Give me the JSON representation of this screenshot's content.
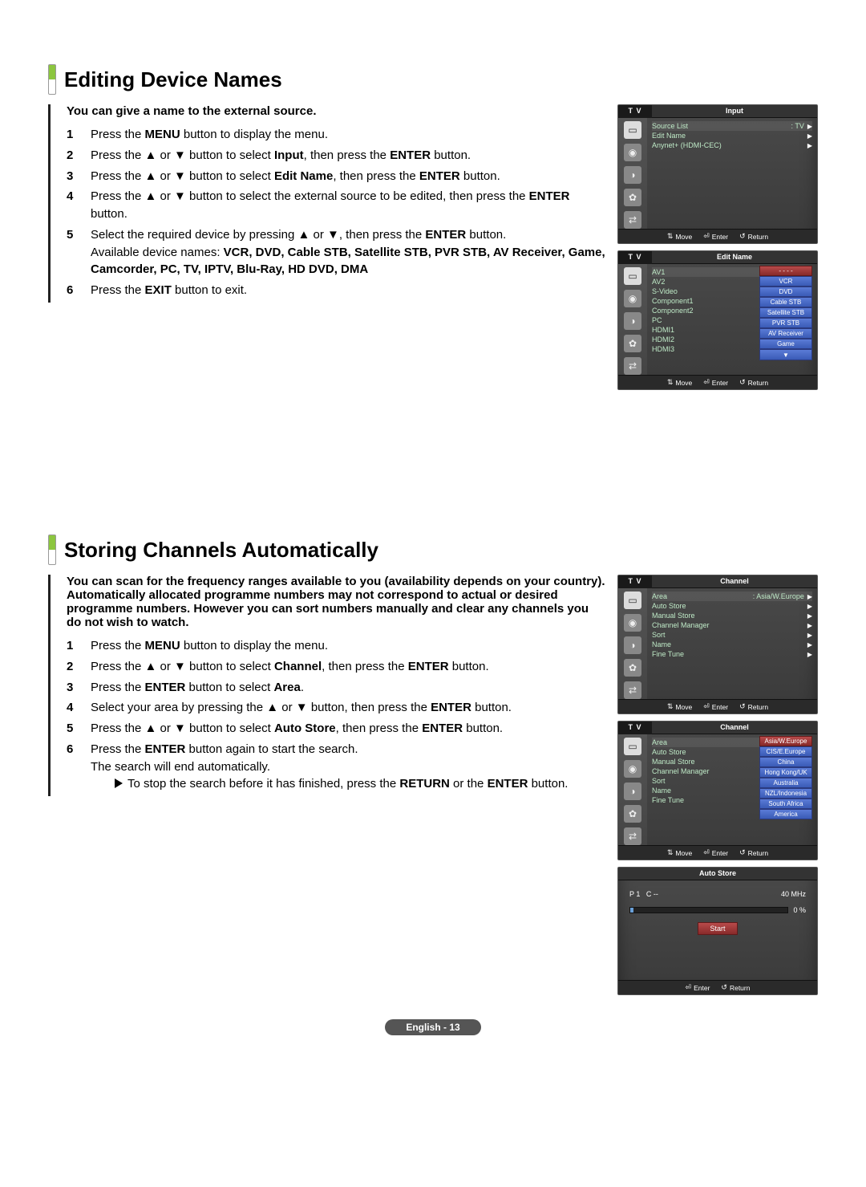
{
  "section1": {
    "title": "Editing Device Names",
    "intro": "You can give a name to the external source.",
    "steps": [
      {
        "n": "1",
        "pre": "Press the ",
        "b1": "MENU",
        "post": " button to display the menu."
      },
      {
        "n": "2",
        "pre": "Press the ▲ or ▼ button to select ",
        "b1": "Input",
        "mid": ", then press the ",
        "b2": "ENTER",
        "post": " button."
      },
      {
        "n": "3",
        "pre": "Press the ▲ or ▼ button to select ",
        "b1": "Edit Name",
        "mid": ", then press the ",
        "b2": "ENTER",
        "post": " button."
      },
      {
        "n": "4",
        "pre": "Press the ▲ or ▼ button to select the external source to be edited, then press the ",
        "b1": "ENTER",
        "post": " button."
      },
      {
        "n": "5",
        "pre": "Select the required device by pressing ▲ or ▼, then press the ",
        "b1": "ENTER",
        "mid": " button.",
        "avail_pre": "Available device names: ",
        "avail_bold": "VCR, DVD, Cable STB, Satellite STB, PVR STB, AV Receiver, Game, Camcorder, PC, TV, IPTV, Blu-Ray, HD DVD, DMA"
      },
      {
        "n": "6",
        "pre": "Press the ",
        "b1": "EXIT",
        "post": " button to exit."
      }
    ]
  },
  "osd_input": {
    "tv": "T V",
    "title": "Input",
    "rows": [
      {
        "label": "Source List",
        "val": ": TV",
        "arrow": "▶"
      },
      {
        "label": "Edit Name",
        "val": "",
        "arrow": "▶"
      },
      {
        "label": "Anynet+ (HDMI-CEC)",
        "val": "",
        "arrow": "▶"
      }
    ],
    "footer": {
      "move": "Move",
      "enter": "Enter",
      "return": "Return"
    }
  },
  "osd_editname": {
    "tv": "T V",
    "title": "Edit Name",
    "rows": [
      "AV1",
      "AV2",
      "S-Video",
      "Component1",
      "Component2",
      "PC",
      "HDMI1",
      "HDMI2",
      "HDMI3"
    ],
    "opts": [
      "- - - -",
      "VCR",
      "DVD",
      "Cable STB",
      "Satellite STB",
      "PVR STB",
      "AV Receiver",
      "Game"
    ],
    "sel_index": 0,
    "footer": {
      "move": "Move",
      "enter": "Enter",
      "return": "Return"
    }
  },
  "section2": {
    "title": "Storing Channels Automatically",
    "intro": "You can scan for the frequency ranges available to you (availability depends on your country).\nAutomatically allocated programme numbers may not correspond to actual or desired programme numbers. However you can sort numbers manually and clear any channels you do not wish to watch.",
    "steps": [
      {
        "n": "1",
        "pre": "Press the ",
        "b1": "MENU",
        "post": " button to display the menu."
      },
      {
        "n": "2",
        "pre": "Press the ▲ or ▼ button to select ",
        "b1": "Channel",
        "mid": ", then press the ",
        "b2": "ENTER",
        "post": " button."
      },
      {
        "n": "3",
        "pre": "Press the ",
        "b1": "ENTER",
        "mid": " button to select ",
        "b2": "Area",
        "post": "."
      },
      {
        "n": "4",
        "pre": "Select your area by pressing the ▲ or ▼ button, then press the ",
        "b1": "ENTER",
        "post": " button."
      },
      {
        "n": "5",
        "pre": "Press the ▲ or ▼ button to select ",
        "b1": "Auto Store",
        "mid": ", then press the ",
        "b2": "ENTER",
        "post": " button."
      },
      {
        "n": "6",
        "pre": "Press the ",
        "b1": "ENTER",
        "mid": " button again to start the search.",
        "post2": "The search will end automatically.",
        "sub_pre": "To stop the search before it has finished, press the ",
        "sub_b": "RETURN",
        "sub_mid": " or the ",
        "sub_b2": "ENTER",
        "sub_post": " button."
      }
    ]
  },
  "osd_channel": {
    "tv": "T V",
    "title": "Channel",
    "rows": [
      {
        "label": "Area",
        "val": ": Asia/W.Europe",
        "arrow": "▶"
      },
      {
        "label": "Auto Store",
        "arrow": "▶"
      },
      {
        "label": "Manual Store",
        "arrow": "▶"
      },
      {
        "label": "Channel Manager",
        "arrow": "▶"
      },
      {
        "label": "Sort",
        "arrow": "▶"
      },
      {
        "label": "Name",
        "arrow": "▶"
      },
      {
        "label": "Fine Tune",
        "arrow": "▶"
      }
    ],
    "footer": {
      "move": "Move",
      "enter": "Enter",
      "return": "Return"
    }
  },
  "osd_channel_area": {
    "tv": "T V",
    "title": "Channel",
    "rows": [
      "Area",
      "Auto Store",
      "Manual Store",
      "Channel Manager",
      "Sort",
      "Name",
      "Fine Tune"
    ],
    "opts": [
      "Asia/W.Europe",
      "CIS/E.Europe",
      "China",
      "Hong Kong/UK",
      "Australia",
      "NZL/Indonesia",
      "South Africa",
      "America"
    ],
    "sel_index": 0,
    "footer": {
      "move": "Move",
      "enter": "Enter",
      "return": "Return"
    }
  },
  "osd_autostore": {
    "title": "Auto Store",
    "p": "P  1",
    "c": "C  --",
    "freq": "40 MHz",
    "pct": "0  %",
    "start": "Start",
    "footer": {
      "enter": "Enter",
      "return": "Return"
    }
  },
  "pagenum": "English - 13"
}
